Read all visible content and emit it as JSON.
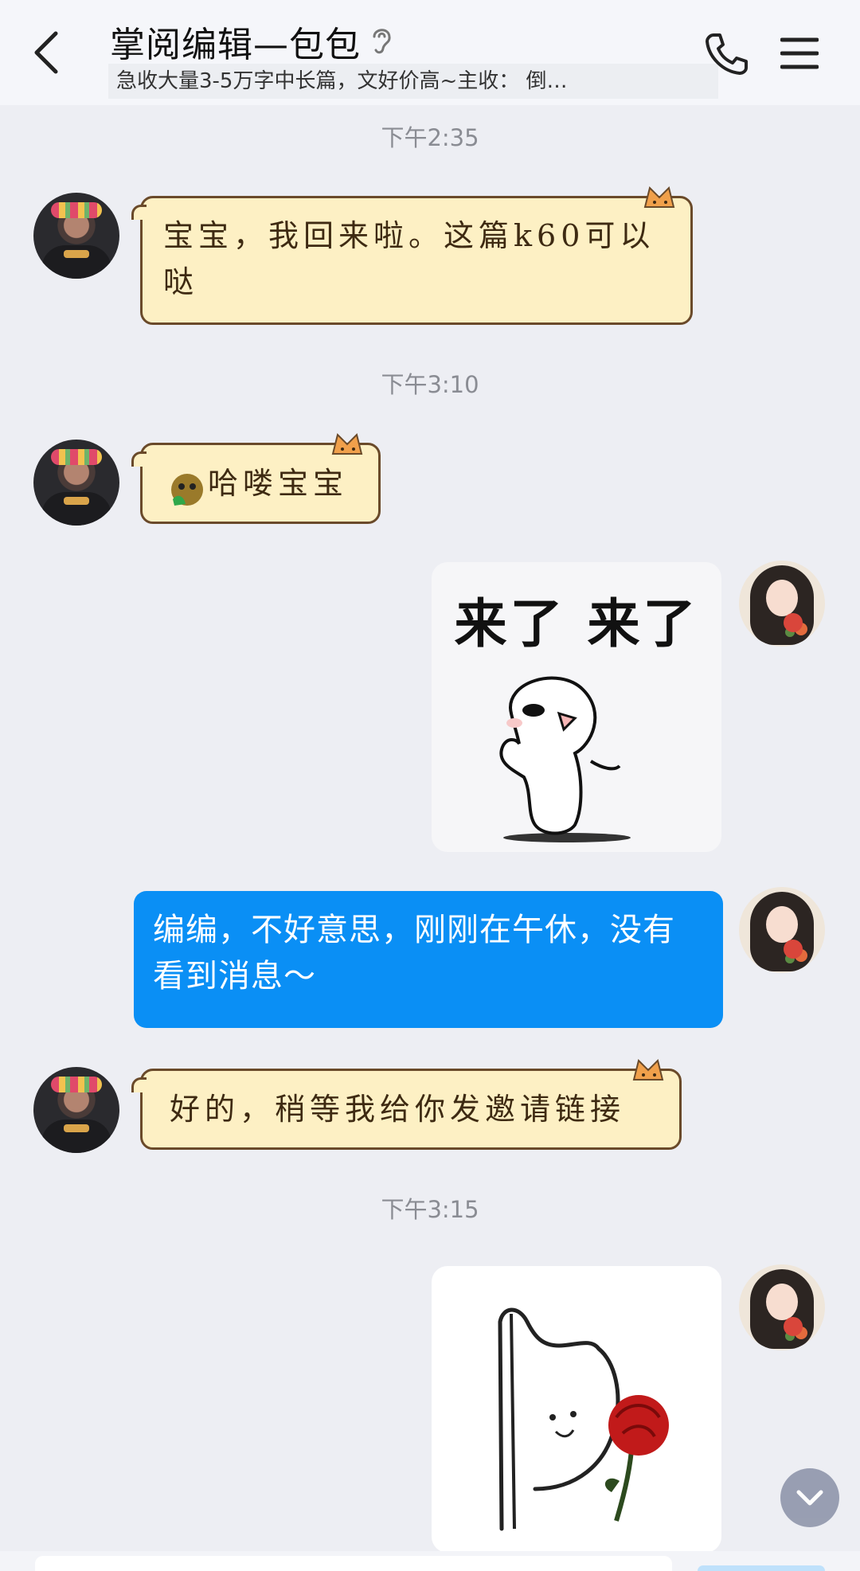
{
  "header": {
    "title": "掌阅编辑—包包",
    "subtitle": "急收大量3-5万字中长篇，文好价高~主收： 倒…",
    "back_icon": "chevron-left-icon",
    "ear_icon": "ear-icon",
    "call_icon": "phone-icon",
    "menu_icon": "menu-icon"
  },
  "messages": [
    {
      "type": "timestamp",
      "text": "下午2:35"
    },
    {
      "type": "text",
      "side": "left",
      "text_line1": "宝宝，我回来啦。这篇k60可以",
      "text_line2": "哒"
    },
    {
      "type": "timestamp",
      "text": "下午3:10"
    },
    {
      "type": "text",
      "side": "left",
      "emoji": "grinning-face-emoji",
      "text": "哈喽宝宝"
    },
    {
      "type": "sticker",
      "side": "right",
      "caption": "来了 来了"
    },
    {
      "type": "text",
      "side": "right",
      "text": "编编，不好意思，刚刚在午休，没有看到消息～"
    },
    {
      "type": "text",
      "side": "left",
      "text": "好的，稍等我给你发邀请链接"
    },
    {
      "type": "timestamp",
      "text": "下午3:15"
    },
    {
      "type": "sticker",
      "side": "right",
      "caption": ""
    }
  ],
  "colors": {
    "background": "#edeef3",
    "bubble_blue": "#0a8ff5",
    "bubble_cat": "#fdf0c4"
  }
}
